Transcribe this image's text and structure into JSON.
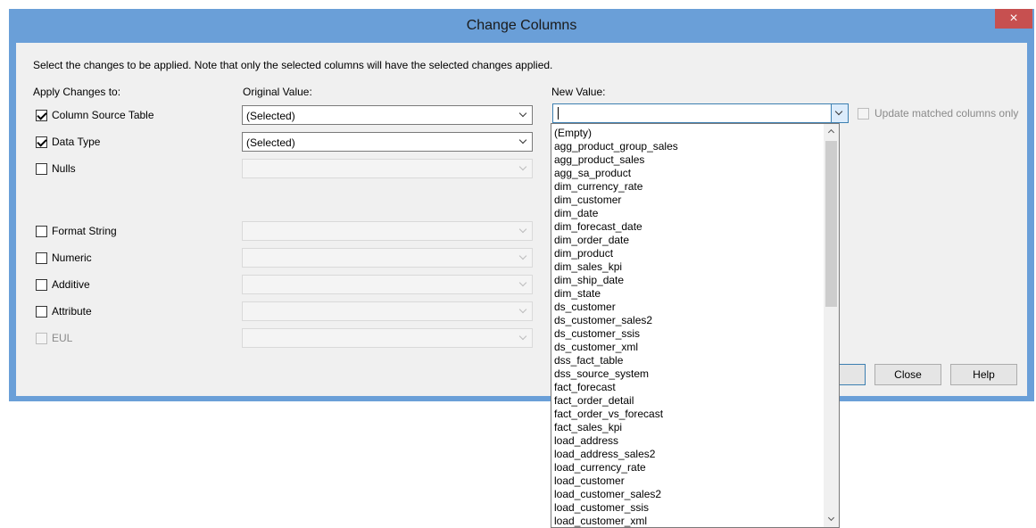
{
  "dialog": {
    "title": "Change Columns",
    "close_glyph": "×",
    "instruction": "Select the changes to be applied. Note that only the selected columns will have the selected changes applied.",
    "headers": {
      "apply": "Apply Changes to:",
      "original": "Original Value:",
      "new": "New Value:"
    },
    "rows": [
      {
        "label": "Column Source Table",
        "checked": true,
        "enabled": true,
        "original": "(Selected)"
      },
      {
        "label": "Data Type",
        "checked": true,
        "enabled": true,
        "original": "(Selected)"
      },
      {
        "label": "Nulls",
        "checked": false,
        "enabled": true,
        "original": ""
      },
      {
        "label": "Format String",
        "checked": false,
        "enabled": true,
        "original": ""
      },
      {
        "label": "Numeric",
        "checked": false,
        "enabled": true,
        "original": ""
      },
      {
        "label": "Additive",
        "checked": false,
        "enabled": true,
        "original": ""
      },
      {
        "label": "Attribute",
        "checked": false,
        "enabled": true,
        "original": ""
      },
      {
        "label": "EUL",
        "checked": false,
        "enabled": false,
        "original": ""
      }
    ],
    "new_value": "",
    "update_matched_label": "Update matched columns only",
    "update_matched_checked": false,
    "buttons": {
      "close": "Close",
      "help": "Help"
    }
  },
  "dropdown": {
    "items": [
      "(Empty)",
      "agg_product_group_sales",
      "agg_product_sales",
      "agg_sa_product",
      "dim_currency_rate",
      "dim_customer",
      "dim_date",
      "dim_forecast_date",
      "dim_order_date",
      "dim_product",
      "dim_sales_kpi",
      "dim_ship_date",
      "dim_state",
      "ds_customer",
      "ds_customer_sales2",
      "ds_customer_ssis",
      "ds_customer_xml",
      "dss_fact_table",
      "dss_source_system",
      "fact_forecast",
      "fact_order_detail",
      "fact_order_vs_forecast",
      "fact_sales_kpi",
      "load_address",
      "load_address_sales2",
      "load_currency_rate",
      "load_customer",
      "load_customer_sales2",
      "load_customer_ssis",
      "load_customer_xml"
    ]
  },
  "colors": {
    "title_bar": "#6a9fd8",
    "close_button": "#c75050",
    "client": "#f0f0f0"
  }
}
